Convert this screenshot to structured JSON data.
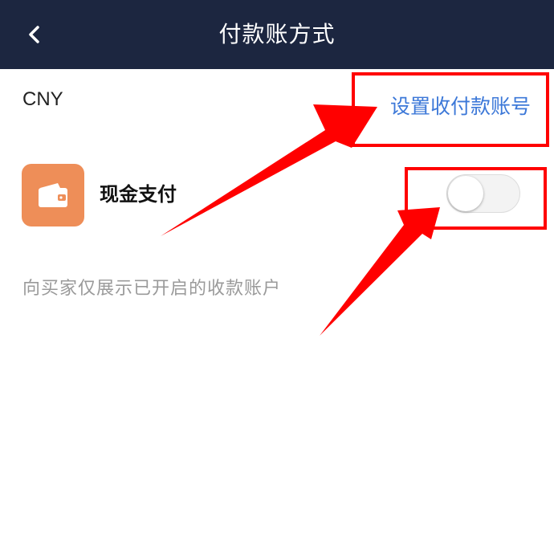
{
  "header": {
    "title": "付款账方式",
    "back_icon": "chevron-left-icon"
  },
  "currency": {
    "code": "CNY",
    "settings_link": "设置收付款账号"
  },
  "payment_methods": [
    {
      "icon": "wallet-icon",
      "icon_color": "#ee8e58",
      "label": "现金支付",
      "enabled": false
    }
  ],
  "note": "向买家仅展示已开启的收款账户",
  "colors": {
    "header_bg": "#1c2640",
    "link": "#3c78d8",
    "annotation": "#ff0000"
  }
}
